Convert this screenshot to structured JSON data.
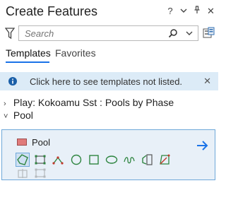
{
  "window": {
    "title": "Create Features",
    "controls": {
      "help": "?",
      "dropdown": "⌄",
      "pin": "⫫",
      "close": "✕"
    }
  },
  "search": {
    "placeholder": "Search",
    "value": ""
  },
  "tabs": [
    {
      "label": "Templates",
      "active": true
    },
    {
      "label": "Favorites",
      "active": false
    }
  ],
  "info": {
    "text": "Click here to see templates not listed.",
    "close": "✕"
  },
  "groups": [
    {
      "label": "Play: Kokoamu Sst : Pools by Phase",
      "expanded": false,
      "chevron": "›"
    },
    {
      "label": "Pool",
      "expanded": true,
      "chevron": "˅"
    }
  ],
  "template": {
    "name": "Pool",
    "swatch_color": "#e07b7b",
    "tools": [
      {
        "icon": "polygon-icon",
        "selected": true
      },
      {
        "icon": "rectangle-icon",
        "selected": false
      },
      {
        "icon": "right-angle-icon",
        "selected": false
      },
      {
        "icon": "circle-icon",
        "selected": false
      },
      {
        "icon": "square-icon",
        "selected": false
      },
      {
        "icon": "ellipse-icon",
        "selected": false
      },
      {
        "icon": "freehand-icon",
        "selected": false
      },
      {
        "icon": "autocomplete-polygon-icon",
        "selected": false
      },
      {
        "icon": "trace-polygon-icon",
        "selected": false
      },
      {
        "icon": "split-polygon-icon",
        "selected": false
      },
      {
        "icon": "fill-polygon-icon",
        "selected": false
      }
    ]
  },
  "colors": {
    "accent": "#1a73e8",
    "info_bg": "#dcebf7",
    "card_bg": "#e8f0f8",
    "card_border": "#6ea8d9"
  }
}
